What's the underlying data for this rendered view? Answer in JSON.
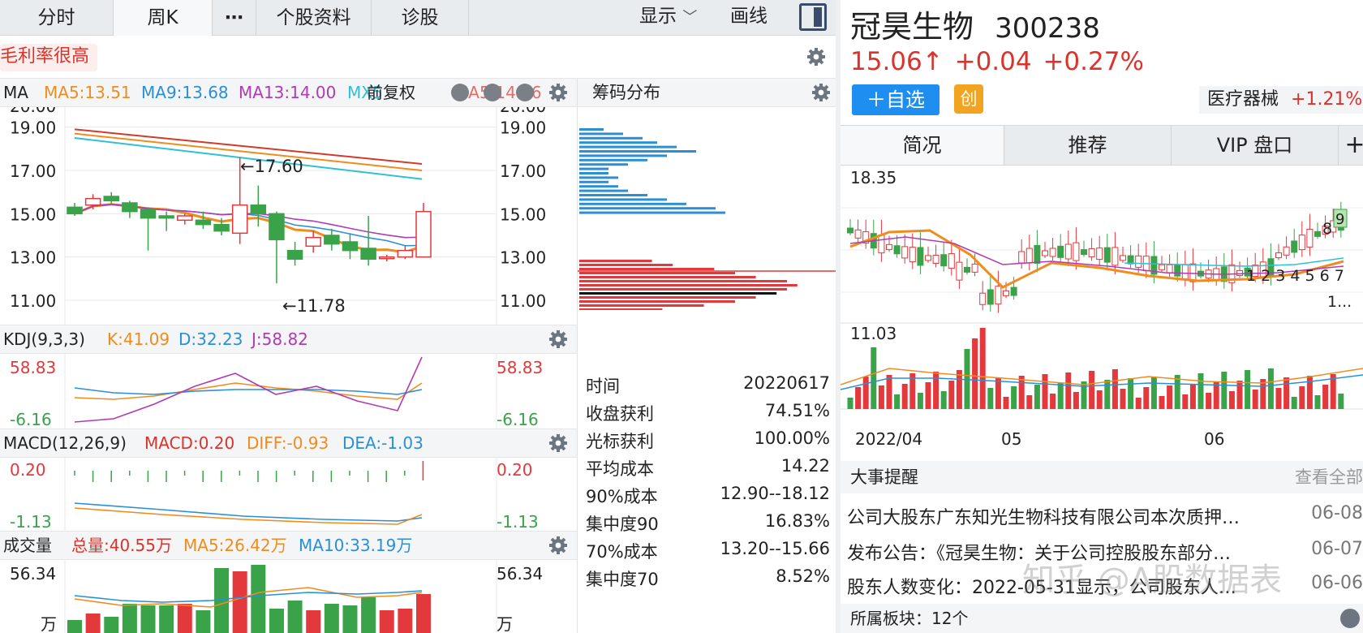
{
  "tabs": [
    {
      "label": "分时"
    },
    {
      "label": "周K"
    },
    {
      "label": "⋯"
    },
    {
      "label": "个股资料"
    },
    {
      "label": "诊股"
    }
  ],
  "toolbar": {
    "display": "显示",
    "draw": "画线"
  },
  "tag": {
    "text": "毛利率很高"
  },
  "ma_bar": {
    "title": "MA",
    "ma5": "MA5:13.51",
    "ma9": "MA9:13.68",
    "ma13": "MA13:14.00",
    "more": "MX5",
    "fq": "前复权",
    "ma_extra": "MA5:14.96",
    "colors": {
      "ma5": "#f08c1e",
      "ma9": "#2b8fd6",
      "ma13": "#b03bb2",
      "cyan": "#2ec0d8"
    }
  },
  "price_axis": [
    "20.00",
    "19.00",
    "17.00",
    "15.00",
    "13.00",
    "11.00"
  ],
  "annotations": {
    "high": "←17.60",
    "low": "←11.78"
  },
  "kdj": {
    "title": "KDJ(9,3,3)",
    "k": "K:41.09",
    "d": "D:32.23",
    "j": "J:58.82",
    "ymax": "58.83",
    "ymin": "-6.16"
  },
  "macd": {
    "title": "MACD(12,26,9)",
    "macd": "MACD:0.20",
    "diff": "DIFF:-0.93",
    "dea": "DEA:-1.03",
    "ymax": "0.20",
    "ymin": "-1.13"
  },
  "vol": {
    "title": "成交量",
    "total": "总量:40.55万",
    "ma5": "MA5:26.42万",
    "ma10": "MA10:33.19万",
    "ymax": "56.34",
    "unit": "万"
  },
  "chips": {
    "title": "筹码分布",
    "rows": [
      {
        "k": "时间",
        "v": "20220617"
      },
      {
        "k": "收盘获利",
        "v": "74.51%"
      },
      {
        "k": "光标获利",
        "v": "100.00%"
      },
      {
        "k": "平均成本",
        "v": "14.22"
      },
      {
        "k": "90%成本",
        "v": "12.90--18.12"
      },
      {
        "k": "集中度90",
        "v": "16.83%"
      },
      {
        "k": "70%成本",
        "v": "13.20--15.66"
      },
      {
        "k": "集中度70",
        "v": "8.52%"
      }
    ]
  },
  "stock": {
    "name": "冠昊生物",
    "code": "300238",
    "price": "15.06↑",
    "change": "+0.04",
    "pct": "+0.27%",
    "add": "＋自选",
    "chuang": "创",
    "sector": "医疗器械",
    "sector_pct": "+1.21%"
  },
  "rtabs": [
    {
      "label": "简况"
    },
    {
      "label": "推荐"
    },
    {
      "label": "VIP 盘口"
    },
    {
      "label": "+"
    }
  ],
  "mini": {
    "high": "18.35",
    "low": "11.03",
    "x_labels": [
      "2022/04",
      "05",
      "06"
    ],
    "nums": "1 2 3 4 5 6 7",
    "n8": "8",
    "n9": "9",
    "n1": "1..."
  },
  "events": {
    "title": "大事提醒",
    "more": "查看全部",
    "items": [
      {
        "t": "公司大股东广东知光生物科技有限公司本次质押…",
        "d": "06-08"
      },
      {
        "t": "发布公告：《冠昊生物：关于公司控股股东部分…",
        "d": "06-07"
      },
      {
        "t": "股东人数变化：2022-05-31显示，公司股东人…",
        "d": "06-06"
      }
    ],
    "board": "所属板块：12个"
  },
  "watermark": "知乎 @A股数据表",
  "chart_data": {
    "type": "candlestick",
    "weekly_ohlc": [
      [
        15.3,
        15.0,
        15.5,
        14.9
      ],
      [
        15.4,
        15.7,
        15.9,
        15.2
      ],
      [
        15.8,
        15.6,
        16.0,
        15.4
      ],
      [
        15.5,
        15.1,
        15.6,
        14.8
      ],
      [
        15.2,
        14.8,
        15.3,
        13.3
      ],
      [
        14.9,
        14.8,
        15.1,
        14.2
      ],
      [
        14.7,
        14.9,
        15.0,
        14.5
      ],
      [
        14.7,
        14.5,
        15.1,
        14.3
      ],
      [
        14.5,
        14.2,
        14.8,
        14.0
      ],
      [
        14.1,
        15.4,
        17.6,
        13.6
      ],
      [
        15.4,
        15.0,
        16.3,
        14.4
      ],
      [
        15.0,
        13.8,
        15.1,
        11.78
      ],
      [
        13.3,
        12.9,
        13.7,
        12.6
      ],
      [
        13.5,
        13.9,
        14.2,
        13.2
      ],
      [
        14.0,
        13.6,
        14.3,
        13.3
      ],
      [
        13.7,
        13.3,
        14.1,
        12.9
      ],
      [
        13.4,
        12.9,
        14.9,
        12.6
      ],
      [
        13.0,
        13.0,
        13.1,
        12.8
      ],
      [
        13.0,
        13.3,
        13.5,
        12.9
      ],
      [
        13.0,
        15.1,
        15.5,
        13.0
      ]
    ],
    "volume": [
      8,
      12,
      10,
      18,
      17,
      17,
      18,
      14,
      40,
      38,
      42,
      15,
      20,
      14,
      18,
      17,
      22,
      14,
      15,
      24
    ],
    "chips_red": [
      0,
      0,
      0,
      0,
      0,
      0,
      0,
      0,
      14,
      18,
      26,
      30,
      34,
      40,
      42,
      40,
      38,
      34,
      30,
      24,
      16,
      11
    ],
    "chips_blue": [
      5,
      9,
      13,
      16,
      20,
      24,
      18,
      14,
      10,
      6,
      6,
      8,
      6,
      8,
      10,
      14,
      18,
      22,
      28,
      30
    ],
    "ylim": [
      11,
      20
    ]
  }
}
